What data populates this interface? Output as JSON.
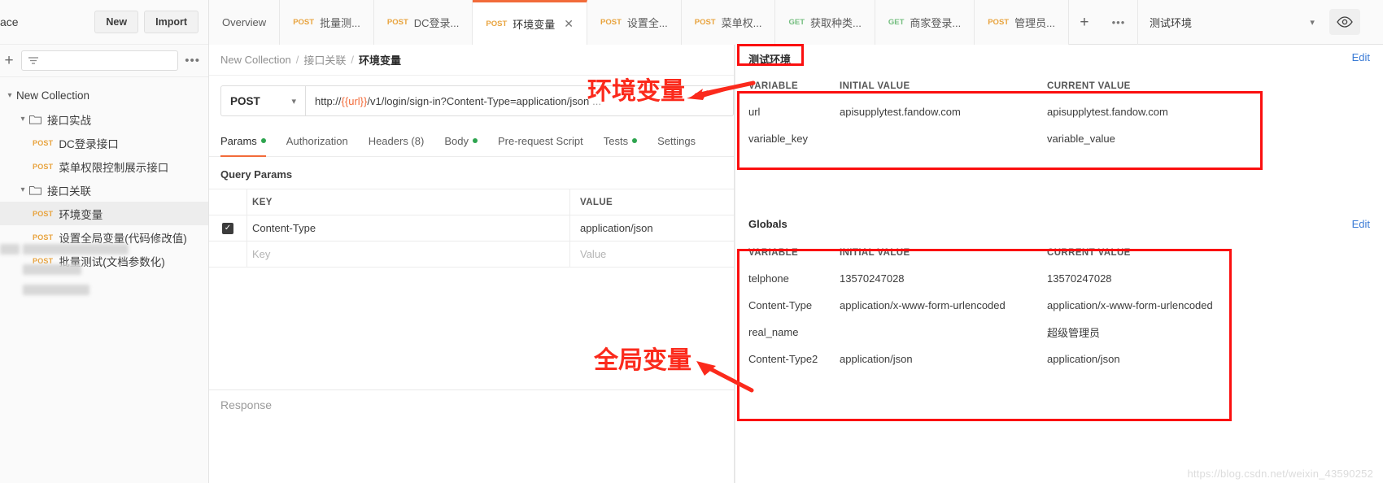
{
  "sidebar": {
    "workspace_title": "ace",
    "new_button": "New",
    "import_button": "Import",
    "filter_placeholder": "",
    "tree": [
      {
        "label": "New Collection",
        "type": "collection",
        "indent": 0,
        "expanded": true
      },
      {
        "label": "接口实战",
        "type": "folder",
        "indent": 1,
        "expanded": true
      },
      {
        "label": "DC登录接口",
        "type": "request",
        "method": "POST",
        "indent": 2
      },
      {
        "label": "菜单权限控制展示接口",
        "type": "request",
        "method": "POST",
        "indent": 2
      },
      {
        "label": "接口关联",
        "type": "folder",
        "indent": 1,
        "expanded": true
      },
      {
        "label": "环境变量",
        "type": "request",
        "method": "POST",
        "indent": 2,
        "selected": true
      },
      {
        "label": "设置全局变量(代码修改值)",
        "type": "request",
        "method": "POST",
        "indent": 2
      },
      {
        "label": "批量测试(文档参数化)",
        "type": "request",
        "method": "POST",
        "indent": 2
      }
    ]
  },
  "tabbar": {
    "tabs": [
      {
        "label": "Overview",
        "method": ""
      },
      {
        "label": "批量测...",
        "method": "POST"
      },
      {
        "label": "DC登录...",
        "method": "POST"
      },
      {
        "label": "环境变量",
        "method": "POST",
        "active": true,
        "closable": true
      },
      {
        "label": "设置全...",
        "method": "POST"
      },
      {
        "label": "菜单权...",
        "method": "POST"
      },
      {
        "label": "获取种类...",
        "method": "GET"
      },
      {
        "label": "商家登录...",
        "method": "GET"
      },
      {
        "label": "管理员...",
        "method": "POST"
      }
    ],
    "add_tab": "+",
    "more_tabs": "•••",
    "environment_selected": "测试环境"
  },
  "request": {
    "breadcrumb": {
      "collection": "New Collection",
      "folder": "接口关联",
      "name": "环境变量",
      "sep": "/"
    },
    "method": "POST",
    "url_prefix": "http://",
    "url_variable": "{{url}}",
    "url_suffix": "/v1/login/sign-in?Content-Type=application/json",
    "url_ellipsis": "...",
    "tabs": [
      {
        "label": "Params",
        "active": true,
        "dot": true
      },
      {
        "label": "Authorization",
        "active": false,
        "dot": false
      },
      {
        "label": "Headers (8)",
        "active": false,
        "dot": false
      },
      {
        "label": "Body",
        "active": false,
        "dot": true
      },
      {
        "label": "Pre-request Script",
        "active": false,
        "dot": false
      },
      {
        "label": "Tests",
        "active": false,
        "dot": true
      },
      {
        "label": "Settings",
        "active": false,
        "dot": false
      }
    ],
    "query_params_title": "Query Params",
    "table": {
      "headers": {
        "key": "KEY",
        "value": "VALUE"
      },
      "rows": [
        {
          "checked": true,
          "key": "Content-Type",
          "value": "application/json"
        }
      ],
      "placeholder_row": {
        "key": "Key",
        "value": "Value"
      }
    },
    "response_label": "Response"
  },
  "environment": {
    "name": "测试环境",
    "edit_label": "Edit",
    "headers": {
      "variable": "VARIABLE",
      "initial": "INITIAL VALUE",
      "current": "CURRENT VALUE"
    },
    "rows": [
      {
        "variable": "url",
        "initial": "apisupplytest.fandow.com",
        "current": "apisupplytest.fandow.com"
      },
      {
        "variable": "variable_key",
        "initial": "",
        "current": "variable_value"
      }
    ]
  },
  "globals": {
    "name": "Globals",
    "edit_label": "Edit",
    "headers": {
      "variable": "VARIABLE",
      "initial": "INITIAL VALUE",
      "current": "CURRENT VALUE"
    },
    "rows": [
      {
        "variable": "telphone",
        "initial": "13570247028",
        "current": "13570247028"
      },
      {
        "variable": "Content-Type",
        "initial": "application/x-www-form-urlencoded",
        "current": "application/x-www-form-urlencoded"
      },
      {
        "variable": "real_name",
        "initial": "",
        "current": "超级管理员"
      },
      {
        "variable": "Content-Type2",
        "initial": "application/json",
        "current": "application/json"
      }
    ]
  },
  "annotations": {
    "env_label": "环境变量",
    "globals_label": "全局变量",
    "accent_red": "#fb0f0f"
  },
  "watermark": "https://blog.csdn.net/weixin_43590252"
}
